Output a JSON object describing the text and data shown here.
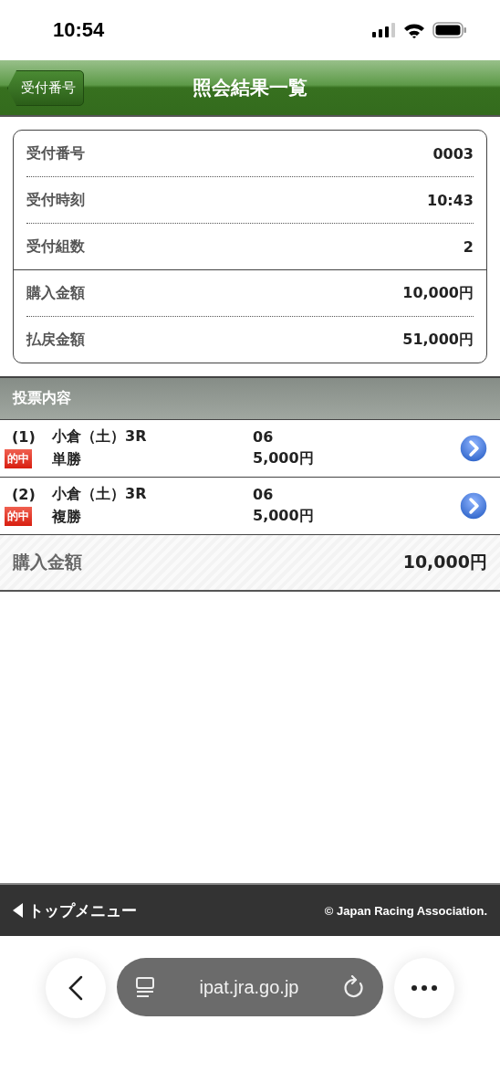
{
  "status_bar": {
    "time": "10:54"
  },
  "header": {
    "back": "受付番号",
    "title": "照会結果一覧"
  },
  "summary": {
    "groups": [
      [
        {
          "label": "受付番号",
          "value": "0003"
        },
        {
          "label": "受付時刻",
          "value": "10:43"
        },
        {
          "label": "受付組数",
          "value": "2"
        }
      ],
      [
        {
          "label": "購入金額",
          "value": "10,000円"
        },
        {
          "label": "払戻金額",
          "value": "51,000円"
        }
      ]
    ]
  },
  "section": {
    "title": "投票内容"
  },
  "bets": [
    {
      "index": "(1)",
      "race": "小倉（土）3R",
      "badge": "的中",
      "type": "単勝",
      "horse": "06",
      "amount": "5,000円"
    },
    {
      "index": "(2)",
      "race": "小倉（土）3R",
      "badge": "的中",
      "type": "複勝",
      "horse": "06",
      "amount": "5,000円"
    }
  ],
  "total": {
    "label": "購入金額",
    "value": "10,000円"
  },
  "footer": {
    "menu": "トップメニュー",
    "copyright": "© Japan Racing Association."
  },
  "browser": {
    "url": "ipat.jra.go.jp"
  }
}
